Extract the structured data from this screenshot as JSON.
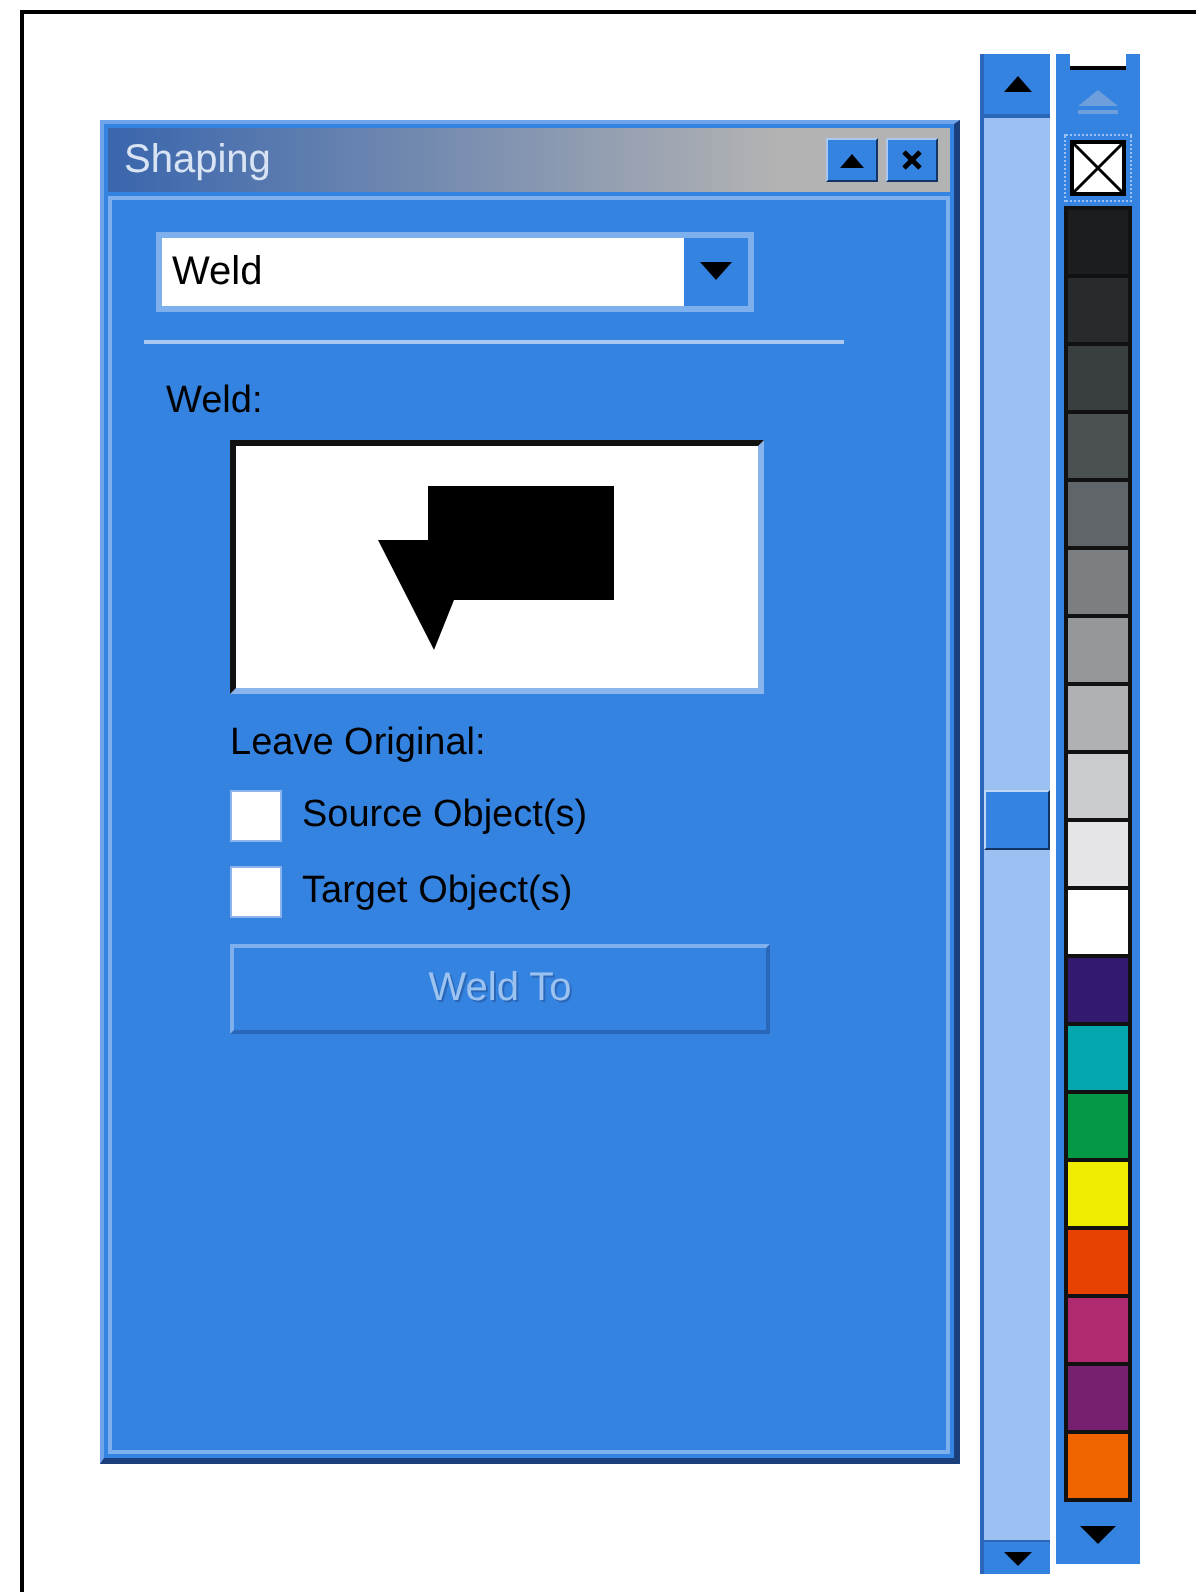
{
  "panel": {
    "title": "Shaping",
    "dropdown": {
      "value": "Weld"
    },
    "section_label": "Weld:",
    "leave_original_label": "Leave Original:",
    "checkboxes": [
      {
        "label": "Source Object(s)",
        "checked": false
      },
      {
        "label": "Target Object(s)",
        "checked": false
      }
    ],
    "button": {
      "label": "Weld To",
      "disabled": true
    }
  },
  "palette": {
    "swatches": [
      {
        "color": "#1c1d1f"
      },
      {
        "color": "#272b2d"
      },
      {
        "color": "#393e40"
      },
      {
        "color": "#4b5053"
      },
      {
        "color": "#5f6568"
      },
      {
        "color": "#7b7f82"
      },
      {
        "color": "#95989b"
      },
      {
        "color": "#b0b1b4"
      },
      {
        "color": "#cbcccf"
      },
      {
        "color": "#e5e5e7"
      },
      {
        "color": "#ffffff"
      },
      {
        "color": "#341a6e"
      },
      {
        "color": "#03a7ad"
      },
      {
        "color": "#039945"
      },
      {
        "color": "#f0ec00"
      },
      {
        "color": "#e84200"
      },
      {
        "color": "#b02a6f"
      },
      {
        "color": "#76206f"
      },
      {
        "color": "#f06400"
      }
    ]
  }
}
